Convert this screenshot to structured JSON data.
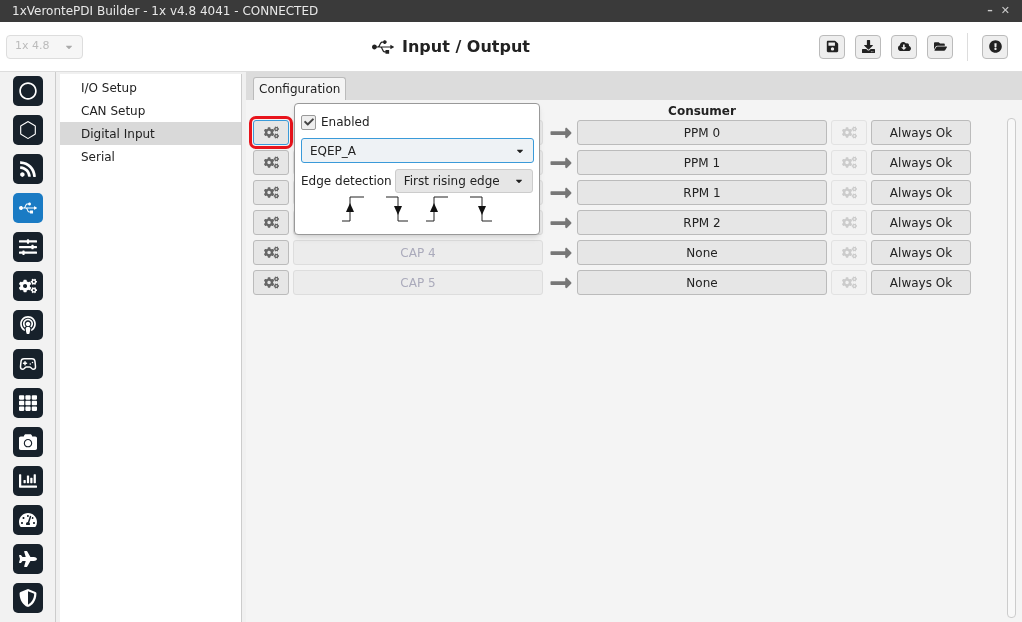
{
  "window": {
    "title": "1xVerontePDI Builder - 1x v4.8 4041 - CONNECTED",
    "controls": [
      "–",
      "✕"
    ]
  },
  "header": {
    "version_select": {
      "value": "1x 4.8",
      "disabled": true
    },
    "title": "Input / Output"
  },
  "rail": [
    {
      "selected": false
    },
    {
      "selected": false
    },
    {
      "selected": false
    },
    {
      "selected": true
    },
    {
      "selected": false
    },
    {
      "selected": false
    },
    {
      "selected": false
    },
    {
      "selected": false
    },
    {
      "selected": false
    },
    {
      "selected": false
    },
    {
      "selected": false
    },
    {
      "selected": false
    },
    {
      "selected": false
    },
    {
      "selected": false
    }
  ],
  "nav": [
    {
      "label": "I/O Setup",
      "selected": false
    },
    {
      "label": "CAN Setup",
      "selected": false
    },
    {
      "label": "Digital Input",
      "selected": true
    },
    {
      "label": "Serial",
      "selected": false
    }
  ],
  "tabs": [
    {
      "label": "Configuration",
      "selected": true
    }
  ],
  "table": {
    "consumer_header": "Consumer",
    "rows": [
      {
        "producer": null,
        "consumer": "PPM 0",
        "status": "Always Ok",
        "highlighted": true
      },
      {
        "producer": null,
        "consumer": "PPM 1",
        "status": "Always Ok",
        "highlighted": false
      },
      {
        "producer": null,
        "consumer": "RPM 1",
        "status": "Always Ok",
        "highlighted": false
      },
      {
        "producer": null,
        "consumer": "RPM 2",
        "status": "Always Ok",
        "highlighted": false
      },
      {
        "producer": "CAP 4",
        "consumer": "None",
        "status": "Always Ok",
        "highlighted": false
      },
      {
        "producer": "CAP 5",
        "consumer": "None",
        "status": "Always Ok",
        "highlighted": false
      }
    ]
  },
  "popup": {
    "enabled": {
      "label": "Enabled",
      "checked": true
    },
    "source": "EQEP_A",
    "edge_label": "Edge detection",
    "edge_value": "First rising edge",
    "edges": [
      {
        "kind": "rising"
      },
      {
        "kind": "falling"
      },
      {
        "kind": "rising"
      },
      {
        "kind": "falling"
      }
    ]
  }
}
